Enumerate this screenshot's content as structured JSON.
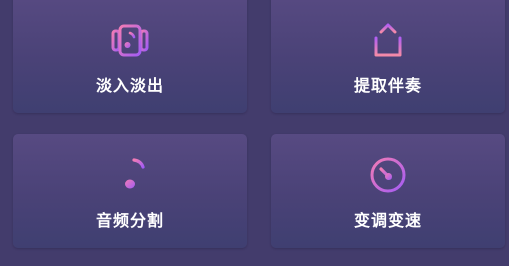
{
  "tools": [
    {
      "label": "淡入淡出",
      "icon": "music-card-icon"
    },
    {
      "label": "提取伴奏",
      "icon": "upload-export-icon"
    },
    {
      "label": "音频分割",
      "icon": "playlist-note-icon"
    },
    {
      "label": "变调变速",
      "icon": "speed-dial-icon"
    }
  ],
  "colors": {
    "background": "#433c6c",
    "card_top": "#574a82",
    "card_bottom": "#3f3f71",
    "icon_gradient_start": "#ef6fb3",
    "icon_gradient_end": "#a45cf5",
    "label_text": "#ffffff"
  }
}
